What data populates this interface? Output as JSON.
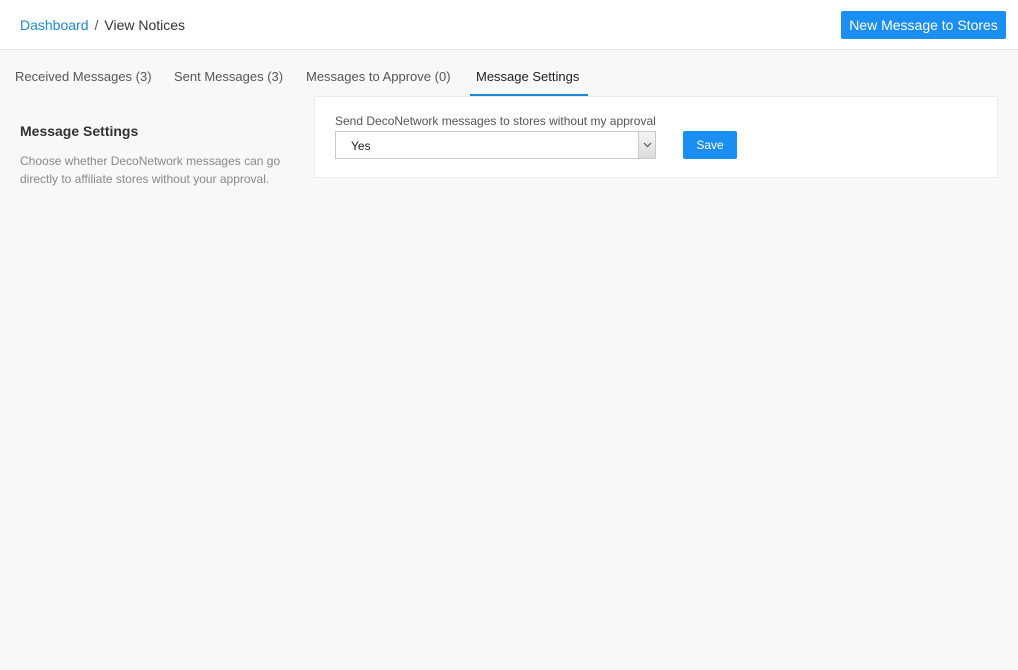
{
  "breadcrumb": {
    "home": "Dashboard",
    "separator": "/",
    "current": "View Notices"
  },
  "header": {
    "new_message_label": "New Message to Stores"
  },
  "tabs": [
    {
      "label": "Received Messages (3)",
      "active": false
    },
    {
      "label": "Sent Messages (3)",
      "active": false
    },
    {
      "label": "Messages to Approve (0)",
      "active": false
    },
    {
      "label": "Message Settings",
      "active": true
    }
  ],
  "settings_section": {
    "title": "Message Settings",
    "description": "Choose whether DecoNetwork messages can go directly to affiliate stores without your approval."
  },
  "settings_form": {
    "field_label": "Send DecoNetwork messages to stores without my approval",
    "select_value": "Yes",
    "save_label": "Save"
  },
  "colors": {
    "accent": "#1b8ef2",
    "link": "#1a8ad8",
    "background": "#f8f8f8"
  }
}
